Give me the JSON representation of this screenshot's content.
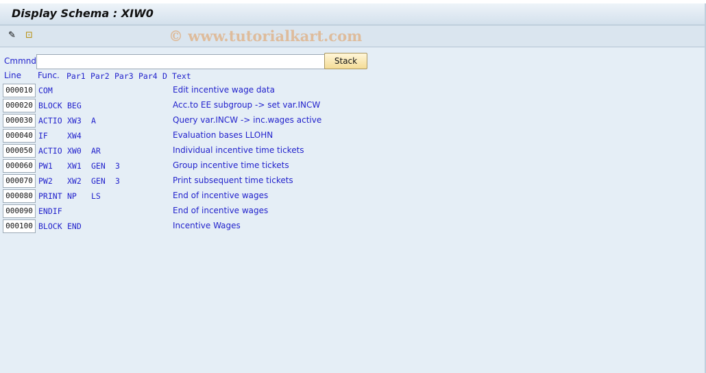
{
  "title": "Display Schema : XIW0",
  "toolbar": {
    "icons": [
      "change-edit-icon",
      "hierarchy-icon"
    ]
  },
  "watermark": "© www.tutorialkart.com",
  "command": {
    "label": "Cmmnd",
    "value": "",
    "stack_label": "Stack"
  },
  "headers": [
    "Line",
    "Func.",
    "Par1",
    "Par2",
    "Par3",
    "Par4",
    "D",
    "Text"
  ],
  "rows": [
    {
      "line": "000010",
      "func": "COM",
      "par1": "",
      "par2": "",
      "par3": "",
      "text": "Edit incentive wage data"
    },
    {
      "line": "000020",
      "func": "BLOCK",
      "par1": "BEG",
      "par2": "",
      "par3": "",
      "text": "Acc.to EE subgroup -> set var.INCW"
    },
    {
      "line": "000030",
      "func": "ACTIO",
      "par1": "XW3",
      "par2": "A",
      "par3": "",
      "text": "Query var.INCW -> inc.wages active"
    },
    {
      "line": "000040",
      "func": "IF",
      "par1": "XW4",
      "par2": "",
      "par3": "",
      "text": "Evaluation bases LLOHN"
    },
    {
      "line": "000050",
      "func": "ACTIO",
      "par1": "XW0",
      "par2": "AR",
      "par3": "",
      "text": "Individual incentive time tickets"
    },
    {
      "line": "000060",
      "func": "PW1",
      "par1": "XW1",
      "par2": "GEN",
      "par3": "3",
      "text": "Group incentive time tickets"
    },
    {
      "line": "000070",
      "func": "PW2",
      "par1": "XW2",
      "par2": "GEN",
      "par3": "3",
      "text": "Print subsequent time tickets"
    },
    {
      "line": "000080",
      "func": "PRINT",
      "par1": "NP",
      "par2": "LS",
      "par3": "",
      "text": "End of incentive wages"
    },
    {
      "line": "000090",
      "func": "ENDIF",
      "par1": "",
      "par2": "",
      "par3": "",
      "text": "End of incentive wages"
    },
    {
      "line": "000100",
      "func": "BLOCK",
      "par1": "END",
      "par2": "",
      "par3": "",
      "text": "Incentive Wages"
    }
  ]
}
